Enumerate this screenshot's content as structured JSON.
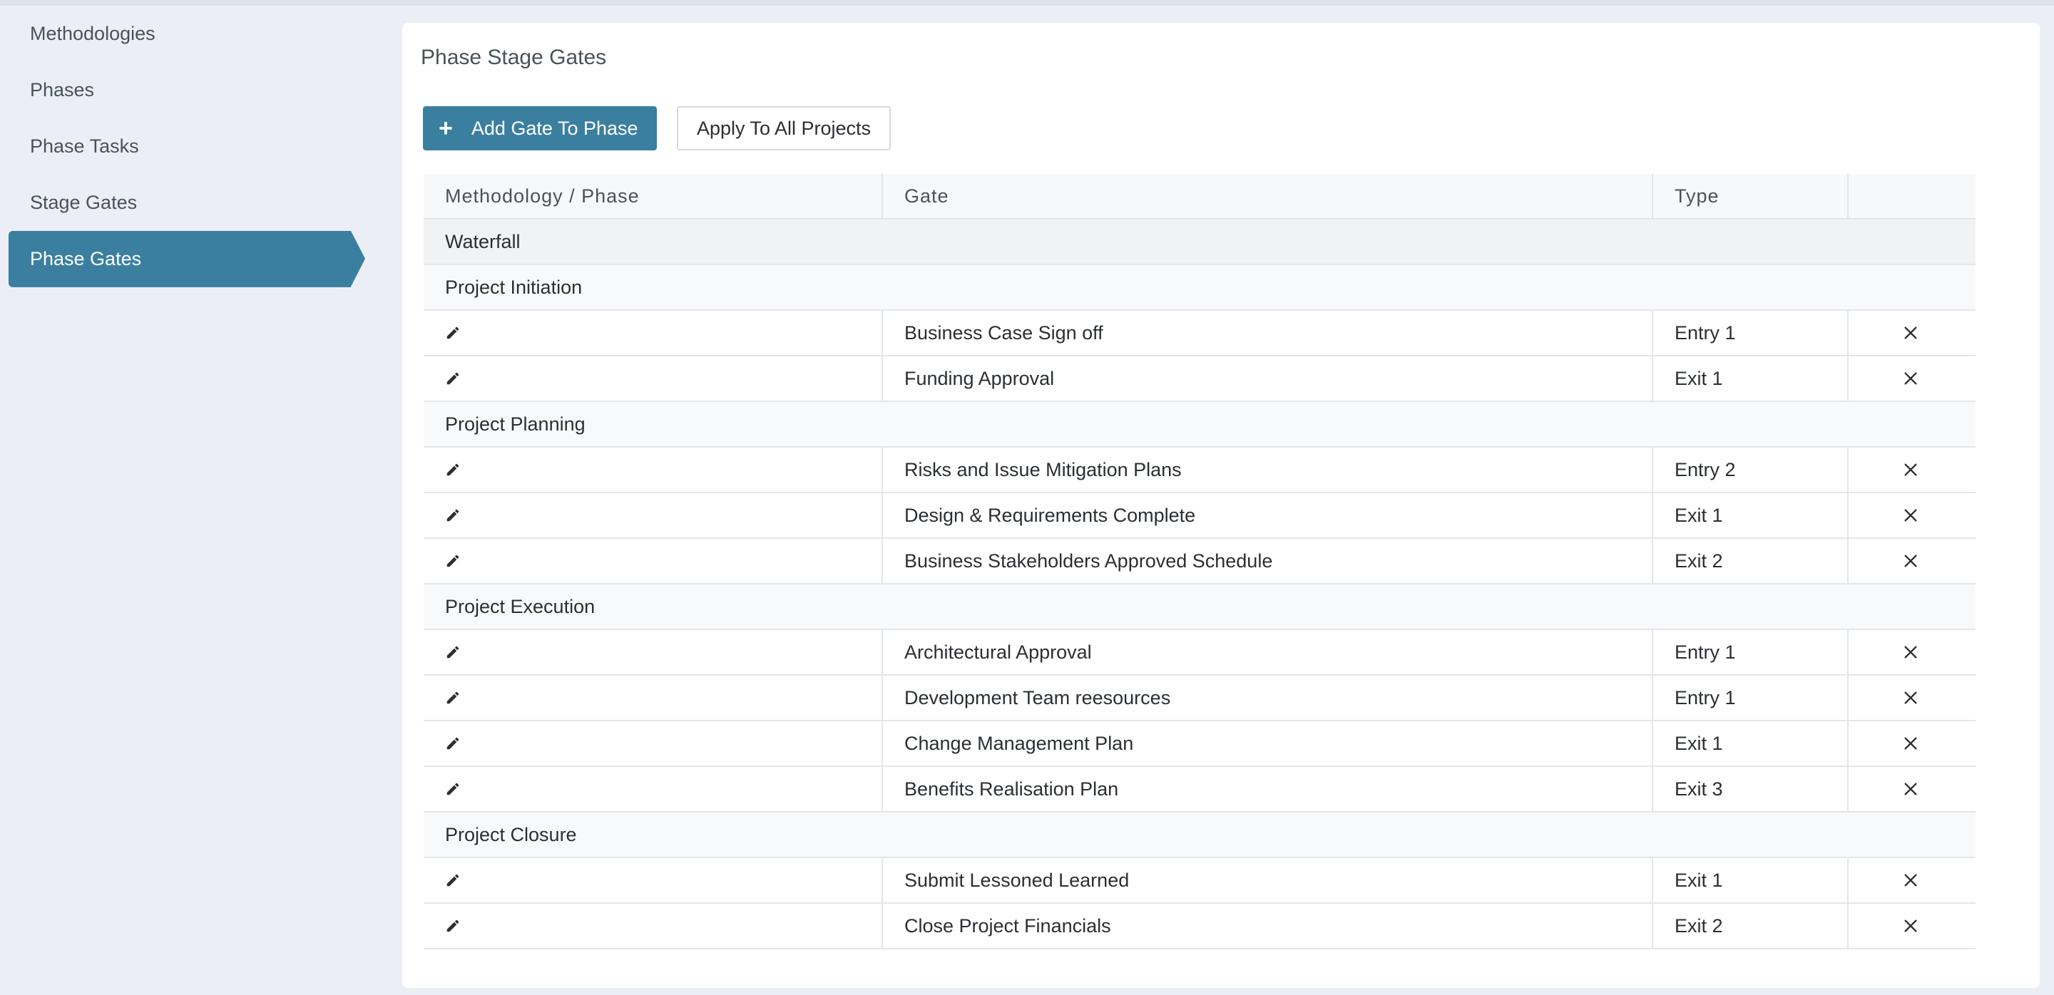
{
  "sidebar": {
    "items": [
      {
        "label": "Methodologies",
        "active": false
      },
      {
        "label": "Phases",
        "active": false
      },
      {
        "label": "Phase Tasks",
        "active": false
      },
      {
        "label": "Stage Gates",
        "active": false
      },
      {
        "label": "Phase Gates",
        "active": true
      }
    ]
  },
  "panel": {
    "title": "Phase Stage Gates",
    "add_button_label": "Add Gate To Phase",
    "apply_button_label": "Apply To All Projects"
  },
  "table": {
    "headers": [
      "Methodology / Phase",
      "Gate",
      "Type",
      ""
    ],
    "methodology": "Waterfall",
    "phases": [
      {
        "name": "Project Initiation",
        "gates": [
          {
            "gate": "Business Case Sign off",
            "type": "Entry 1"
          },
          {
            "gate": "Funding Approval",
            "type": "Exit 1"
          }
        ]
      },
      {
        "name": "Project Planning",
        "gates": [
          {
            "gate": "Risks and Issue Mitigation Plans",
            "type": "Entry 2"
          },
          {
            "gate": "Design & Requirements Complete",
            "type": "Exit 1"
          },
          {
            "gate": "Business Stakeholders Approved Schedule",
            "type": "Exit 2"
          }
        ]
      },
      {
        "name": "Project Execution",
        "gates": [
          {
            "gate": "Architectural Approval",
            "type": "Entry 1"
          },
          {
            "gate": "Development Team reesources",
            "type": "Entry 1"
          },
          {
            "gate": "Change Management Plan",
            "type": "Exit 1"
          },
          {
            "gate": "Benefits Realisation Plan",
            "type": "Exit 3"
          }
        ]
      },
      {
        "name": "Project Closure",
        "gates": [
          {
            "gate": "Submit Lessoned Learned",
            "type": "Exit 1"
          },
          {
            "gate": "Close Project Financials",
            "type": "Exit 2"
          }
        ]
      }
    ]
  },
  "icons": {
    "edit": "pencil-icon",
    "delete": "close-icon",
    "add": "plus-icon"
  },
  "colors": {
    "accent": "#3b7fa0",
    "background": "#ebeff5"
  }
}
